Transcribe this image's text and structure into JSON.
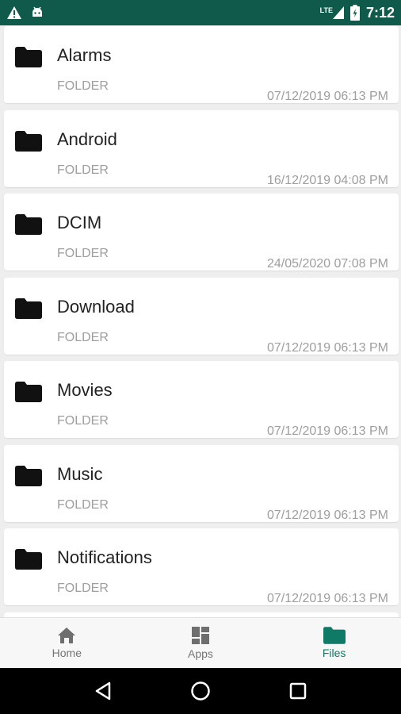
{
  "status_bar": {
    "time": "7:12",
    "network": "LTE",
    "left_icons": [
      "warning-icon",
      "android-icon"
    ],
    "background": "#0f5a4a"
  },
  "files": [
    {
      "name": "Alarms",
      "type": "FOLDER",
      "date": "07/12/2019 06:13 PM"
    },
    {
      "name": "Android",
      "type": "FOLDER",
      "date": "16/12/2019 04:08 PM"
    },
    {
      "name": "DCIM",
      "type": "FOLDER",
      "date": "24/05/2020 07:08 PM"
    },
    {
      "name": "Download",
      "type": "FOLDER",
      "date": "07/12/2019 06:13 PM"
    },
    {
      "name": "Movies",
      "type": "FOLDER",
      "date": "07/12/2019 06:13 PM"
    },
    {
      "name": "Music",
      "type": "FOLDER",
      "date": "07/12/2019 06:13 PM"
    },
    {
      "name": "Notifications",
      "type": "FOLDER",
      "date": "07/12/2019 06:13 PM"
    }
  ],
  "bottom_nav": {
    "items": [
      {
        "label": "Home",
        "icon": "home-icon"
      },
      {
        "label": "Apps",
        "icon": "apps-icon"
      },
      {
        "label": "Files",
        "icon": "folder-icon",
        "active": true
      }
    ],
    "accent": "#0f7a66"
  },
  "system_nav": {
    "icons": [
      "back-icon",
      "home-circle-icon",
      "recents-icon"
    ]
  }
}
